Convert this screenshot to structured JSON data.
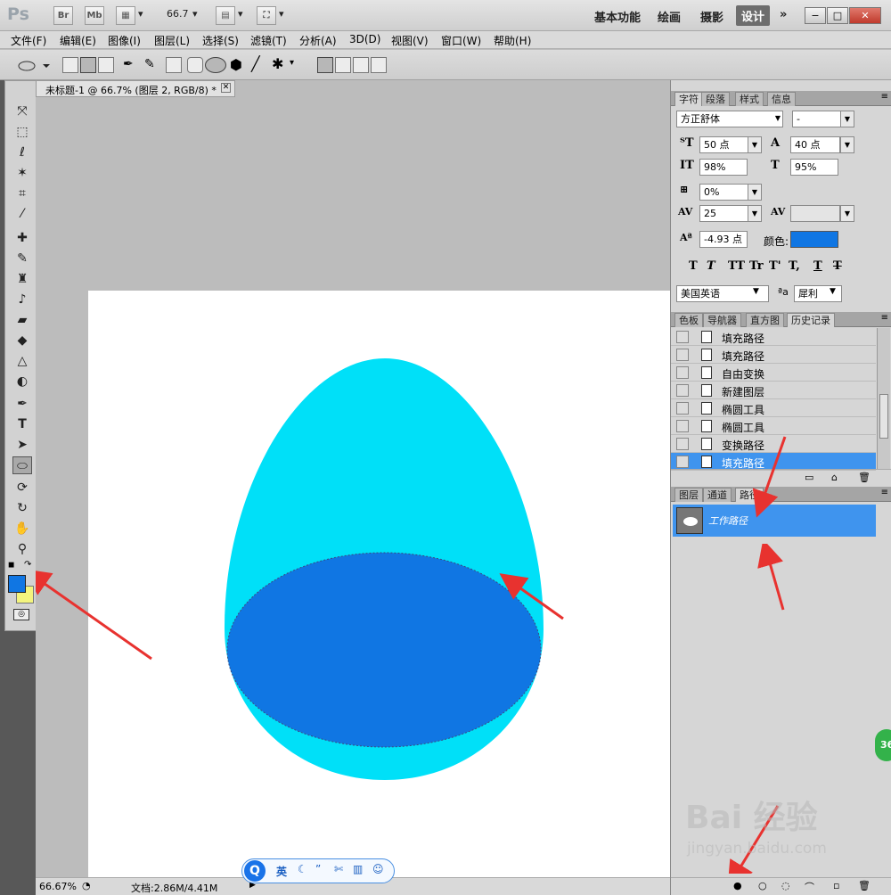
{
  "app": {
    "logo": "Ps",
    "bridge_label": "Br",
    "minibridge_label": "Mb",
    "zoom_dropdown": "66.7",
    "workspaces": [
      "基本功能",
      "绘画",
      "摄影",
      "设计"
    ],
    "active_workspace": "设计",
    "more_label": "»"
  },
  "menu": [
    "文件(F)",
    "编辑(E)",
    "图像(I)",
    "图层(L)",
    "选择(S)",
    "滤镜(T)",
    "分析(A)",
    "3D(D)",
    "视图(V)",
    "窗口(W)",
    "帮助(H)"
  ],
  "document": {
    "tab_title": "未标题-1 @ 66.7% (图层 2, RGB/8) *",
    "zoom_status": "66.67%",
    "doc_status": "文档:2.86M/4.41M",
    "fill_light": "#00e0f8",
    "fill_dark": "#1076e3"
  },
  "char_panel": {
    "tabs": [
      "字符",
      "段落",
      "样式",
      "信息"
    ],
    "font_family": "方正舒体",
    "font_style": "-",
    "font_size": "50 点",
    "leading": "40 点",
    "vscale": "98%",
    "hscale": "95%",
    "tracking_pct": "0%",
    "tracking": "25",
    "kerning": "",
    "baseline": "-4.93 点",
    "color_label": "颜色:",
    "color": "#1076e3",
    "language": "美国英语",
    "antialias_icon": "ªa",
    "antialias": "犀利",
    "style_buttons": [
      "T",
      "T",
      "TT",
      "Tr",
      "T'",
      "T,",
      "T",
      "T"
    ]
  },
  "history_panel": {
    "tabs": [
      "色板",
      "导航器",
      "直方图",
      "历史记录"
    ],
    "items": [
      "填充路径",
      "填充路径",
      "自由变换",
      "新建图层",
      "椭圆工具",
      "椭圆工具",
      "变换路径",
      "填充路径"
    ],
    "selected_index": 7
  },
  "layers_panel": {
    "tabs": [
      "图层",
      "通道",
      "路径"
    ],
    "path_name": "工作路径"
  },
  "ime": {
    "logo": "Q",
    "lang": "英"
  },
  "watermark": {
    "text": "Bai 经验",
    "url": "jingyan.baidu.com"
  },
  "badge": "36"
}
